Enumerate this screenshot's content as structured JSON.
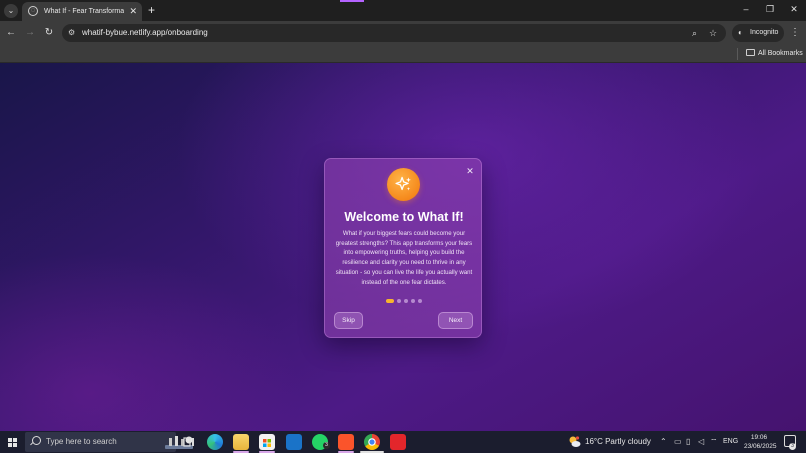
{
  "browser": {
    "tab": {
      "title": "What If - Fear Transformation A"
    },
    "new_tab_glyph": "+",
    "url": "whatif-bybue.netlify.app/onboarding",
    "incognito_label": "Incognito",
    "bookmarks_label": "All Bookmarks",
    "colors": {
      "chrome_dark": "#1f1f1f",
      "toolbar": "#3c3c3c"
    }
  },
  "modal": {
    "title": "Welcome to What If!",
    "body": "What if your biggest fears could become your greatest strengths? This app transforms your fears into empowering truths, helping you build the resilience and clarity you need to thrive in any situation - so you can live the life you actually want instead of the one fear dictates.",
    "icon": "sparkles-icon",
    "close_glyph": "✕",
    "step_count": 5,
    "active_step": 1,
    "skip_label": "Skip",
    "next_label": "Next",
    "colors": {
      "accent": "#f5891c",
      "active_dot": "#f7b52d",
      "background_top": "#191649",
      "background_bottom": "#4d1a86"
    }
  },
  "taskbar": {
    "search_placeholder": "Type here to search",
    "weather": "16°C  Partly cloudy",
    "language": "ENG",
    "time": "19:06",
    "date": "23/06/2025",
    "whatsapp_badge": "3",
    "notification_count": "3"
  }
}
